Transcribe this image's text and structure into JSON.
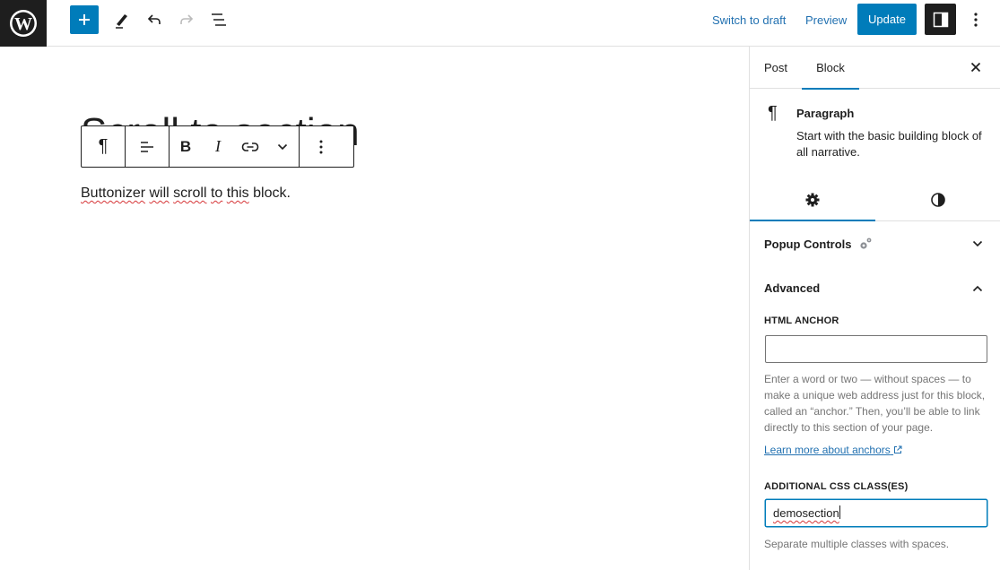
{
  "topbar": {
    "switch_draft": "Switch to draft",
    "preview": "Preview",
    "update": "Update"
  },
  "editor": {
    "title": "Scroll to section",
    "paragraph_words": [
      "Buttonizer",
      "will",
      "scroll",
      "to",
      "this",
      "block."
    ]
  },
  "sidebar": {
    "tabs": {
      "post": "Post",
      "block": "Block"
    },
    "block_card": {
      "title": "Paragraph",
      "description": "Start with the basic building block of all narrative."
    },
    "panels": {
      "popup_controls": "Popup Controls",
      "advanced": "Advanced"
    },
    "html_anchor": {
      "label": "HTML ANCHOR",
      "value": "",
      "help": "Enter a word or two — without spaces — to make a unique web address just for this block, called an “anchor.” Then, you’ll be able to link directly to this section of your page.",
      "link": "Learn more about anchors"
    },
    "css_classes": {
      "label": "ADDITIONAL CSS CLASS(ES)",
      "value": "demosection",
      "help": "Separate multiple classes with spaces."
    }
  },
  "colors": {
    "accent": "#007cba",
    "link": "#2271b1",
    "dark": "#1e1e1e",
    "border": "#e0e0e0",
    "muted": "#757575"
  }
}
